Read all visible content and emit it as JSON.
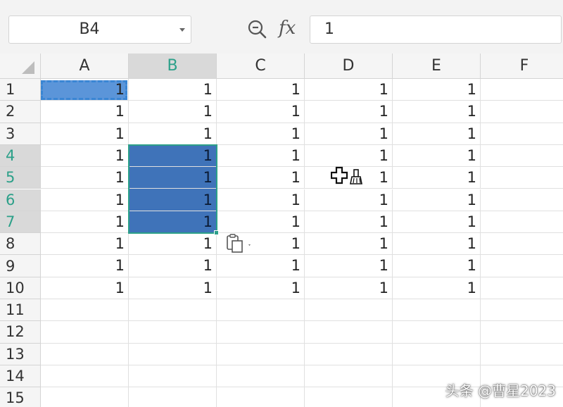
{
  "formula_bar": {
    "name_box": "B4",
    "fx_label": "fx",
    "formula_value": "1"
  },
  "columns": [
    "A",
    "B",
    "C",
    "D",
    "E",
    "F"
  ],
  "selected_column": "B",
  "rows": [
    "1",
    "2",
    "3",
    "4",
    "5",
    "6",
    "7",
    "8",
    "9",
    "10",
    "11",
    "12",
    "13",
    "14",
    "15"
  ],
  "selected_rows": [
    "4",
    "5",
    "6",
    "7"
  ],
  "data_rows": [
    [
      "1",
      "1",
      "1",
      "1",
      "1",
      ""
    ],
    [
      "1",
      "1",
      "1",
      "1",
      "1",
      ""
    ],
    [
      "1",
      "1",
      "1",
      "1",
      "1",
      ""
    ],
    [
      "1",
      "1",
      "1",
      "1",
      "1",
      ""
    ],
    [
      "1",
      "1",
      "1",
      "1",
      "1",
      ""
    ],
    [
      "1",
      "1",
      "1",
      "1",
      "1",
      ""
    ],
    [
      "1",
      "1",
      "1",
      "1",
      "1",
      ""
    ],
    [
      "1",
      "1",
      "1",
      "1",
      "1",
      ""
    ],
    [
      "1",
      "1",
      "1",
      "1",
      "1",
      ""
    ],
    [
      "1",
      "1",
      "1",
      "1",
      "1",
      ""
    ]
  ],
  "colors": {
    "selection_accent": "#2ca089",
    "selection_fill": "#3f73b9",
    "copy_marquee": "#3a86d4"
  },
  "icons": {
    "zoom": "zoom-search-icon",
    "paste_options": "paste-options-icon",
    "cursor": "move-format-painter-cursor-icon"
  },
  "watermark": "头条 @曹星2023"
}
